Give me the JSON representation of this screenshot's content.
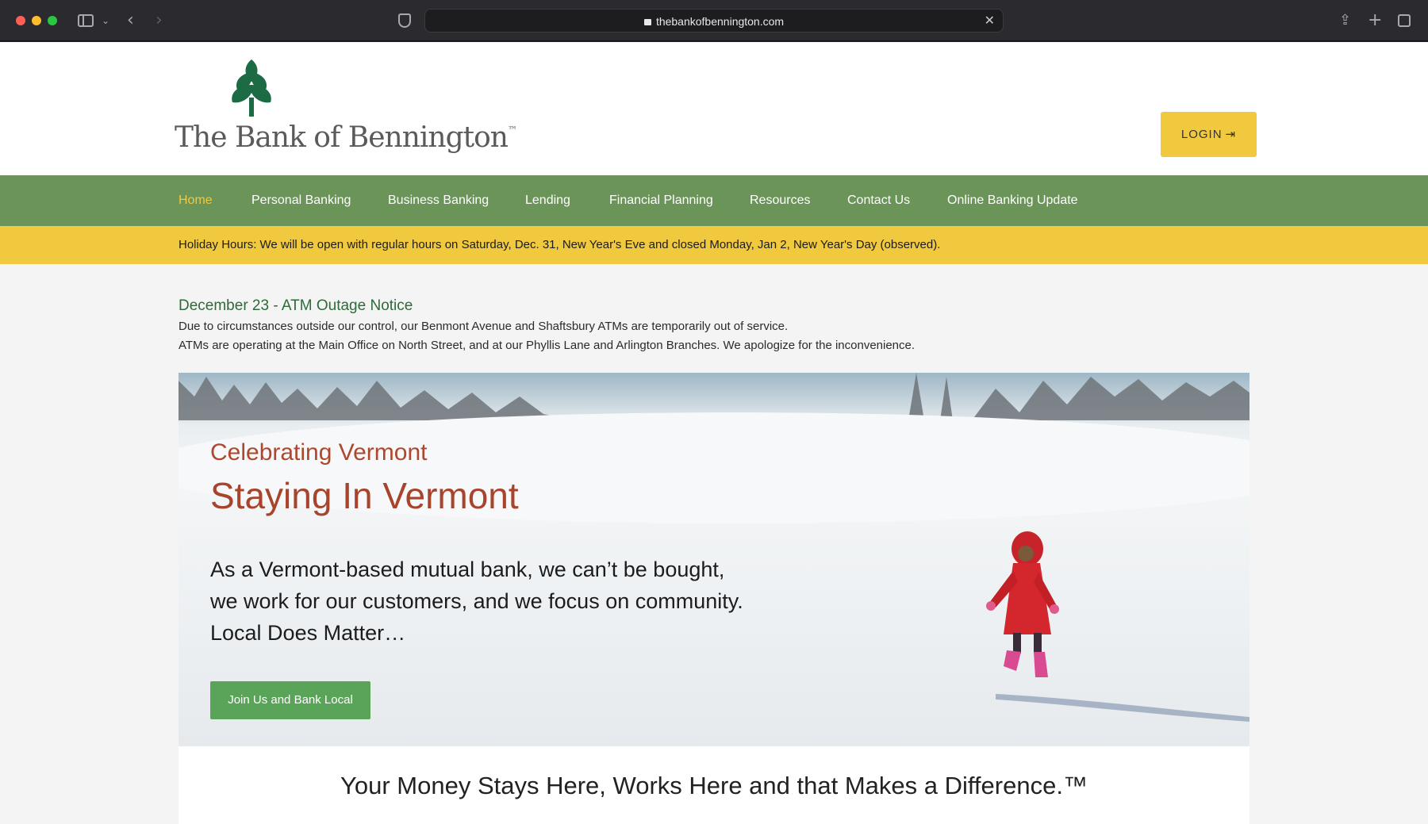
{
  "browser": {
    "url": "thebankofbennington.com"
  },
  "header": {
    "logo_text": "The Bank of Bennington",
    "logo_tm": "™",
    "login_label": "LOGIN"
  },
  "nav": {
    "items": [
      {
        "label": "Home",
        "active": true
      },
      {
        "label": "Personal Banking"
      },
      {
        "label": "Business Banking"
      },
      {
        "label": "Lending"
      },
      {
        "label": "Financial Planning"
      },
      {
        "label": "Resources"
      },
      {
        "label": "Contact Us"
      },
      {
        "label": "Online Banking Update"
      }
    ]
  },
  "alert": {
    "text": "Holiday Hours: We will be open with regular hours on Saturday, Dec. 31, New Year's Eve and closed Monday, Jan 2, New Year's Day (observed)."
  },
  "notice": {
    "title": "December 23 - ATM Outage Notice",
    "line1": "Due to circumstances outside our control, our Benmont Avenue and Shaftsbury ATMs are temporarily out of service.",
    "line2": "ATMs are operating at the Main Office on North Street, and at our Phyllis Lane and Arlington Branches. We apologize for the inconvenience."
  },
  "hero": {
    "kicker": "Celebrating Vermont",
    "title": "Staying In Vermont",
    "body": "As a Vermont-based mutual bank, we can’t be bought, we work for our customers, and we focus on community. Local Does Matter…",
    "button_label": "Join Us and Bank Local"
  },
  "tagline": {
    "text": "Your Money Stays Here, Works Here and that Makes a Difference.™"
  },
  "colors": {
    "nav_green": "#6a9458",
    "accent_yellow": "#f0c93f",
    "hero_red": "#a8432c",
    "button_green": "#5aa45a",
    "notice_green": "#2e6a3a"
  }
}
